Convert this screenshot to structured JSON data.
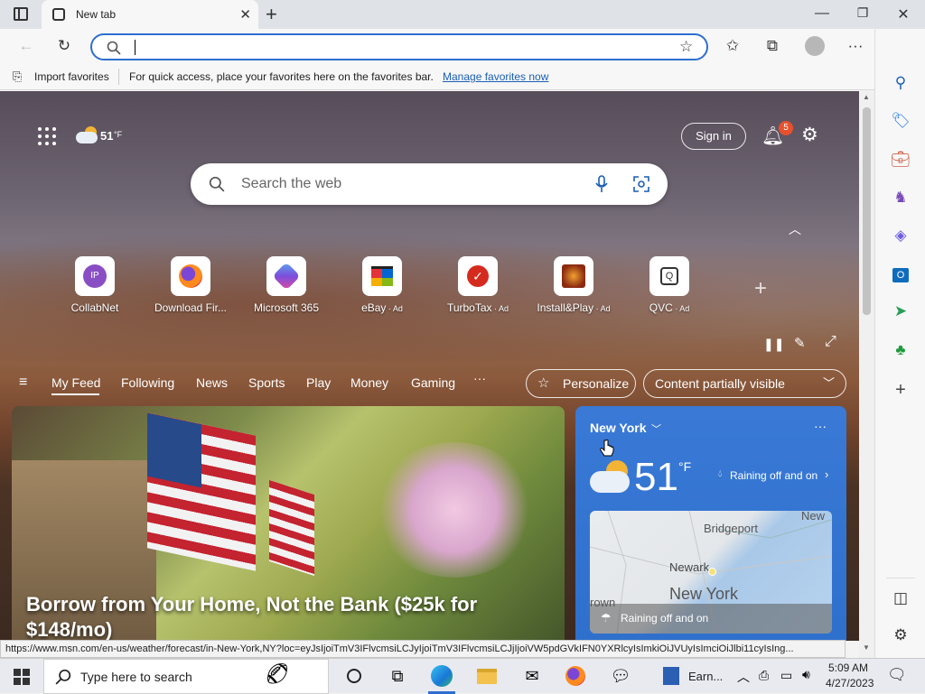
{
  "browser": {
    "tab_title": "New tab",
    "address_value": "",
    "favbar": {
      "import_label": "Import favorites",
      "message": "For quick access, place your favorites here on the favorites bar.",
      "manage_link": "Manage favorites now"
    }
  },
  "page": {
    "weather_temp": "51",
    "weather_unit": "°F",
    "sign_in": "Sign in",
    "notification_count": "5",
    "search_placeholder": "Search the web",
    "tiles": [
      {
        "initials": "IP",
        "label": "CollabNet",
        "ad": ""
      },
      {
        "initials": "",
        "label": "Download Fir...",
        "ad": ""
      },
      {
        "initials": "",
        "label": "Microsoft 365",
        "ad": ""
      },
      {
        "initials": "",
        "label": "eBay",
        "ad": " · Ad"
      },
      {
        "initials": "",
        "label": "TurboTax",
        "ad": " · Ad"
      },
      {
        "initials": "",
        "label": "Install&Play",
        "ad": " · Ad"
      },
      {
        "initials": "",
        "label": "QVC",
        "ad": " · Ad"
      }
    ],
    "nav": [
      "My Feed",
      "Following",
      "News",
      "Sports",
      "Play",
      "Money",
      "Gaming"
    ],
    "more": "···",
    "personalize": "Personalize",
    "content_visibility": "Content partially visible",
    "headline": "Borrow from Your Home, Not the Bank ($25k for $148/mo)",
    "weather_card": {
      "location": "New York",
      "temp": "51",
      "unit": "°F",
      "condition": "Raining off and on",
      "map_labels": [
        "Bridgeport",
        "New",
        "Newark",
        "New York",
        "rown"
      ],
      "map_banner": "Raining off and on"
    }
  },
  "status_url": "https://www.msn.com/en-us/weather/forecast/in-New-York,NY?loc=eyJsIjoiTmV3IFlvcmsiLCJyIjoiTmV3IFlvcmsiLCJjIjoiVW5pdGVkIFN0YXRlcyIsImkiOiJVUyIsImciOiJlbi11cyIsIng...",
  "taskbar": {
    "search_placeholder": "Type here to search",
    "app_label": "Earn...",
    "time": "5:09 AM",
    "date": "4/27/2023"
  },
  "colors": {
    "accent": "#2e6ed0",
    "notification_badge": "#e8512e",
    "weather_card": "#3a7ad6"
  }
}
